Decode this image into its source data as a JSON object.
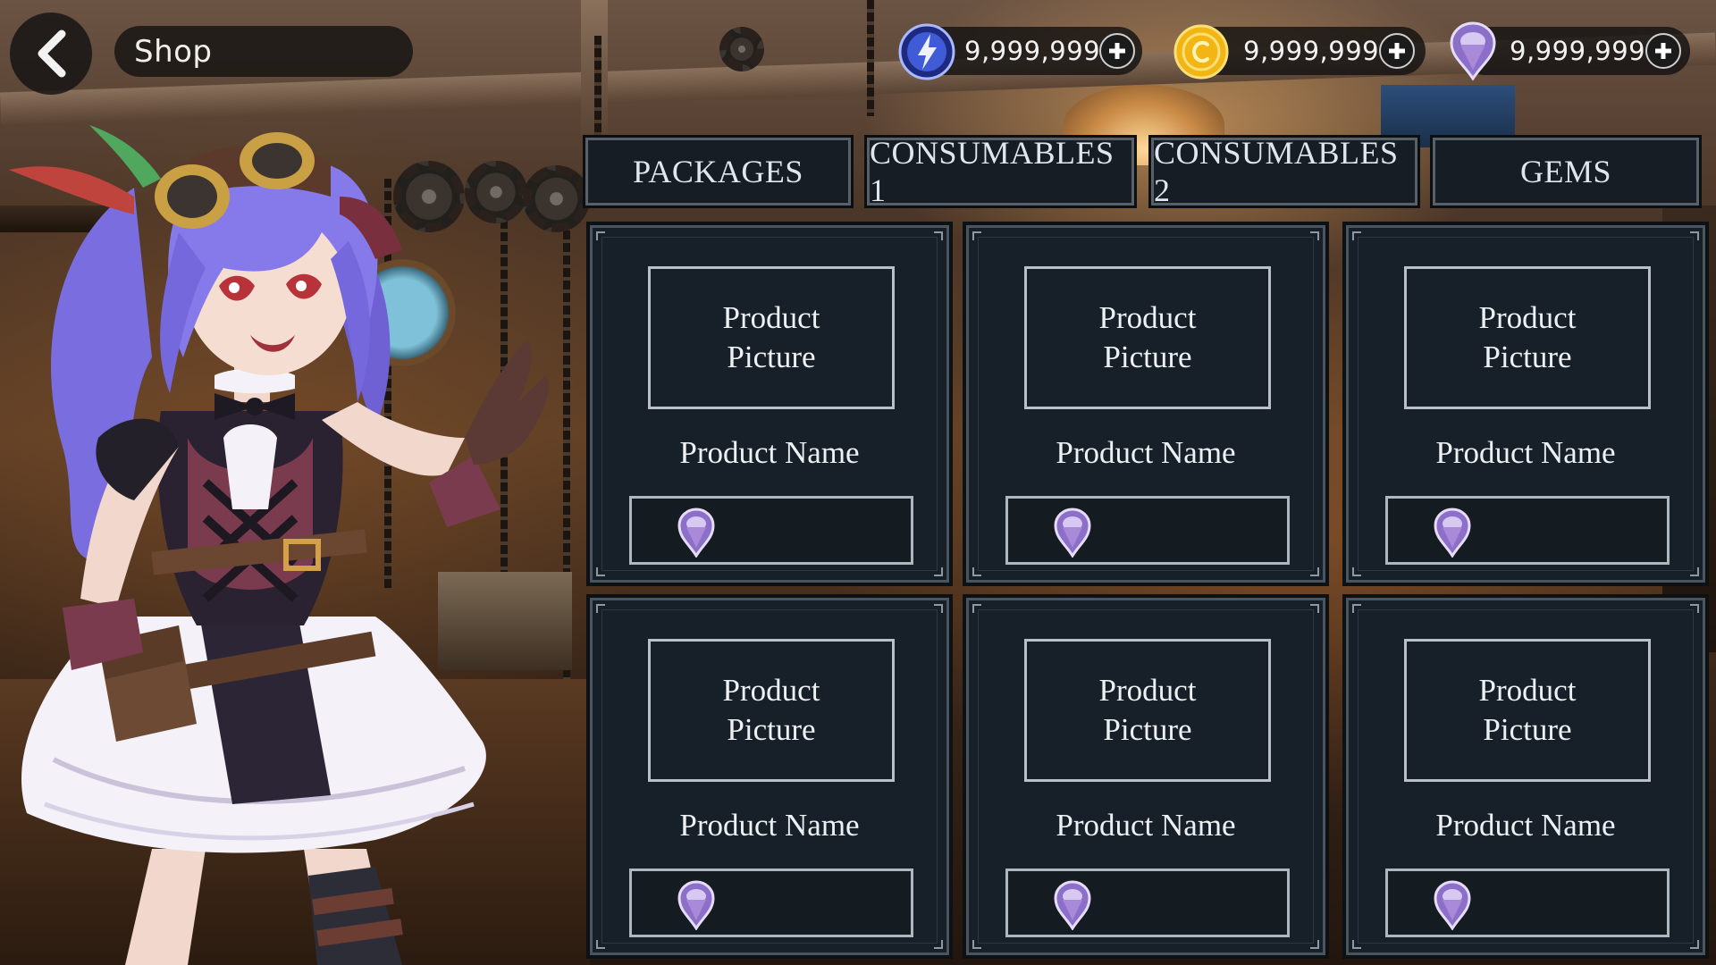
{
  "header": {
    "back_icon": "chevron-left-icon",
    "title": "Shop"
  },
  "currencies": [
    {
      "icon": "energy-orb-icon",
      "amount": "9,999,999",
      "color": "#3f5bd6"
    },
    {
      "icon": "gold-coin-icon",
      "amount": "9,999,999",
      "color": "#f0b417"
    },
    {
      "icon": "purple-gem-icon",
      "amount": "9,999,999",
      "color": "#9a7fd0"
    }
  ],
  "tabs": [
    {
      "label": "PACKAGES"
    },
    {
      "label": "CONSUMABLES 1"
    },
    {
      "label": "CONSUMABLES 2"
    },
    {
      "label": "GEMS"
    }
  ],
  "products": [
    {
      "picture": "Product\nPicture",
      "name": "Product Name",
      "price_icon": "purple-gem-icon"
    },
    {
      "picture": "Product\nPicture",
      "name": "Product Name",
      "price_icon": "purple-gem-icon"
    },
    {
      "picture": "Product\nPicture",
      "name": "Product Name",
      "price_icon": "purple-gem-icon"
    },
    {
      "picture": "Product\nPicture",
      "name": "Product Name",
      "price_icon": "purple-gem-icon"
    },
    {
      "picture": "Product\nPicture",
      "name": "Product Name",
      "price_icon": "purple-gem-icon"
    },
    {
      "picture": "Product\nPicture",
      "name": "Product Name",
      "price_icon": "purple-gem-icon"
    }
  ],
  "colors": {
    "panel": "#172028",
    "panel_border": "#4b5560",
    "text": "#eef1f4",
    "hud_pill": "#161414"
  }
}
